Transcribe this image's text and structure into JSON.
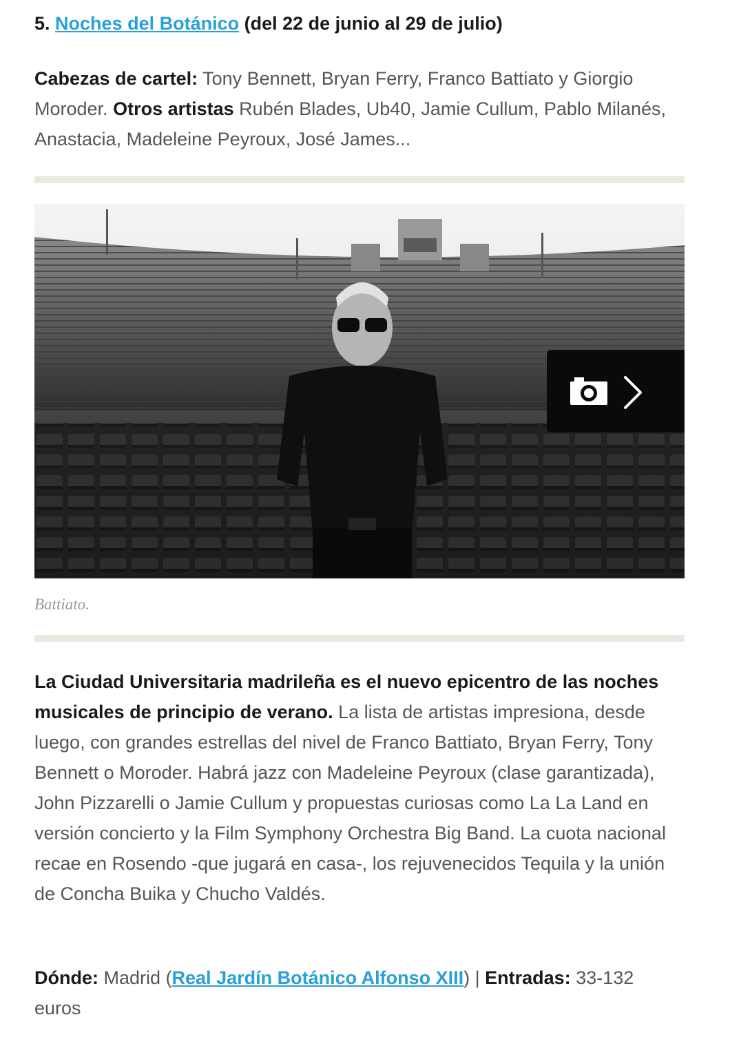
{
  "heading": {
    "number": "5.",
    "link_text": "Noches del Botánico",
    "dates": "(del 22 de junio al 29 de julio)"
  },
  "lineup": {
    "headliners_label": "Cabezas de cartel:",
    "headliners": "Tony Bennett, Bryan Ferry, Franco Battiato y Giorgio Moroder.",
    "others_label": "Otros artistas",
    "others": "Rubén Blades, Ub40, Jamie Cullum, Pablo Milanés, Anastacia, Madeleine Peyroux, José James..."
  },
  "photo": {
    "caption": "Battiato.",
    "gallery_icons": [
      "camera-icon",
      "chevron-right-icon"
    ]
  },
  "article": {
    "lead_bold": "La Ciudad Universitaria madrileña es el nuevo epicentro de las noches musicales de principio de verano.",
    "body": "La lista de artistas impresiona, desde luego, con grandes estrellas del nivel de Franco Battiato, Bryan Ferry, Tony Bennett o Moroder. Habrá jazz con Madeleine Peyroux (clase garantizada), John Pizzarelli o Jamie Cullum y propuestas curiosas como La La Land en versión concierto y la Film Symphony Orchestra Big Band. La cuota nacional recae en Rosendo -que jugará en casa-, los rejuvenecidos Tequila y la unión de Concha Buika y Chucho Valdés."
  },
  "info": {
    "where_label": "Dónde:",
    "city": "Madrid (",
    "venue_link": "Real Jardín Botánico Alfonso XIII",
    "separator": ") |",
    "tickets_label": "Entradas:",
    "tickets": "33-132 euros"
  },
  "colors": {
    "link": "#2a9fd8",
    "body_text": "#555555",
    "bold_text": "#1a1a1a",
    "caption": "#9a9a8e",
    "rule": "#e9e9e2"
  }
}
